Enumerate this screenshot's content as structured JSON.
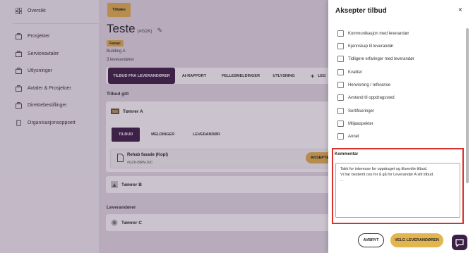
{
  "sidebar": {
    "items": [
      {
        "label": "Oversikt",
        "icon": "grid-icon"
      },
      {
        "label": "Prosjekter",
        "icon": "briefcase-icon"
      },
      {
        "label": "Serviceavtaler",
        "icon": "briefcase-icon"
      },
      {
        "label": "Utlysninger",
        "icon": "briefcase-icon"
      },
      {
        "label": "Avtaler & Prosjekter",
        "icon": "briefcase-icon"
      },
      {
        "label": "Direktebestillinger",
        "icon": "briefcase-icon"
      },
      {
        "label": "Organisasjonsoppsett",
        "icon": "phone-icon"
      }
    ]
  },
  "main": {
    "back_label": "Tilbake",
    "title": "Teste",
    "code": "(#G2K)",
    "badge": "Famac",
    "building": "Building A",
    "supplier_count": "3 leverandører",
    "tabs": [
      "TILBUD FRA LEVERANDØRER",
      "AI-RAPPORT",
      "FELLESMELDINGER",
      "UTLYSNING",
      "LEG"
    ],
    "add_symbol": "+",
    "offers_heading": "Tilbud gitt",
    "suppliers_heading": "Leverandører",
    "supplier_a": {
      "name": "Tømrer A",
      "subtabs": [
        "TILBUD",
        "MELDINGER",
        "LEVERANDØR"
      ],
      "offer_title": "Rehab fasade (Kopi)",
      "offer_id": "#G2K-BBW-26C",
      "accept_label": "AKSEPTER"
    },
    "supplier_b": {
      "name": "Tømrer B"
    },
    "supplier_c": {
      "name": "Tømrer C"
    }
  },
  "panel": {
    "title": "Aksepter tilbud",
    "close": "×",
    "criteria": [
      "Kommunikasjon med leverandør",
      "Kjennskap til leverandør",
      "Tidligere erfaringer med leverandør",
      "Kvalitet",
      "Henvisning / referanse",
      "Avstand til oppdragssted",
      "Sertifiseringer",
      "Miljøaspekter",
      "Annet"
    ],
    "comment_label": "Kommentar",
    "comment_text": "Takk for interesse for oppdraget og tilsendte tilbud.\nVi har bestemt oss for å gå for Leverandør A sitt tilbud.\n...",
    "cancel_label": "AVBRYT",
    "choose_label": "VELG LEVERANDØREN"
  },
  "colors": {
    "accent": "#e3b54e",
    "dark": "#3b1f45",
    "highlight": "#d9302a"
  }
}
